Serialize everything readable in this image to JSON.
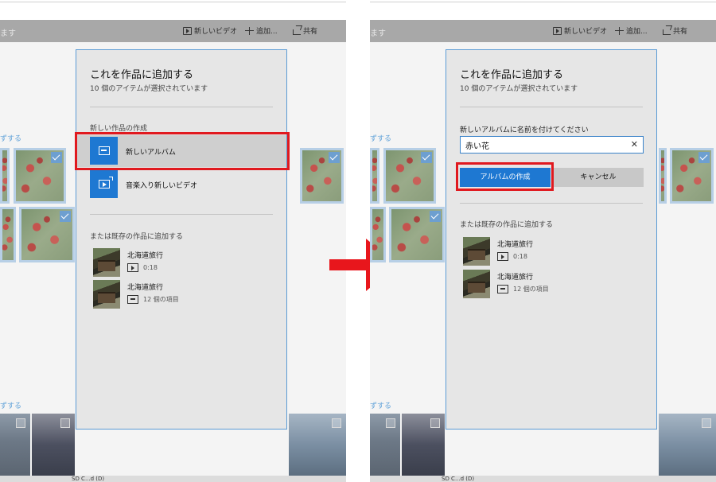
{
  "colors": {
    "accent": "#1e78d2",
    "highlight": "#e0191f",
    "arrow": "#e8161c",
    "panel": "#e6e6e6"
  },
  "appbar": {
    "cut_text": "ます",
    "commands": [
      {
        "label": "新しいビデオ",
        "icon": "video-icon"
      },
      {
        "label": "追加...",
        "icon": "plus-icon"
      },
      {
        "label": "共有",
        "icon": "share-icon"
      }
    ]
  },
  "background": {
    "section_label": "ずする"
  },
  "panel": {
    "title": "これを作品に追加する",
    "subtitle": "10 個のアイテムが選択されています",
    "new_section_label": "新しい作品の作成",
    "new_album_label": "新しいアルバム",
    "new_video_label": "音楽入り新しいビデオ",
    "existing_label": "または既存の作品に追加する",
    "existing": [
      {
        "name": "北海道旅行",
        "meta": "0:18",
        "icon": "video-icon"
      },
      {
        "name": "北海道旅行",
        "meta": "12 個の項目",
        "icon": "album-icon"
      }
    ]
  },
  "naming": {
    "field_label": "新しいアルバムに名前を付けてください",
    "field_value": "赤い花",
    "clear_glyph": "✕",
    "create_label": "アルバムの作成",
    "cancel_label": "キャンセル"
  },
  "taskbar": {
    "text": "SD C...d (D)"
  }
}
